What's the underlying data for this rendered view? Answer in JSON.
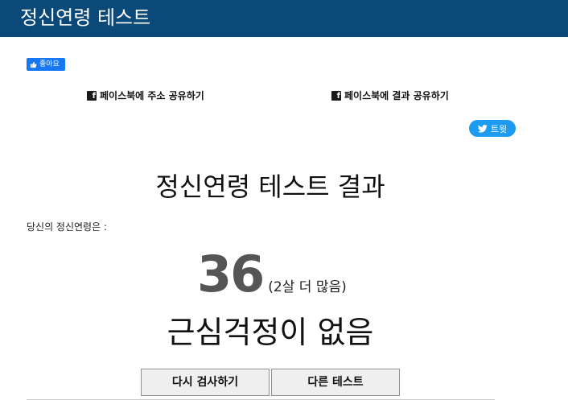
{
  "header": {
    "title": "정신연령 테스트",
    "background_color": "#0b4a78"
  },
  "social": {
    "like_label": "좋아요",
    "share_address_label": "페이스북에 주소 공유하기",
    "share_result_label": "페이스북에 결과 공유하기",
    "tweet_label": "트윗",
    "facebook_color": "#1877f2",
    "twitter_color": "#1d9bf0"
  },
  "result": {
    "heading": "정신연령 테스트 결과",
    "age_label": "당신의 정신연령은 :",
    "age_value": "36",
    "age_diff": "(2살 더 많음)",
    "status": "근심걱정이 없음"
  },
  "buttons": {
    "retry_label": "다시 검사하기",
    "other_test_label": "다른 테스트"
  }
}
